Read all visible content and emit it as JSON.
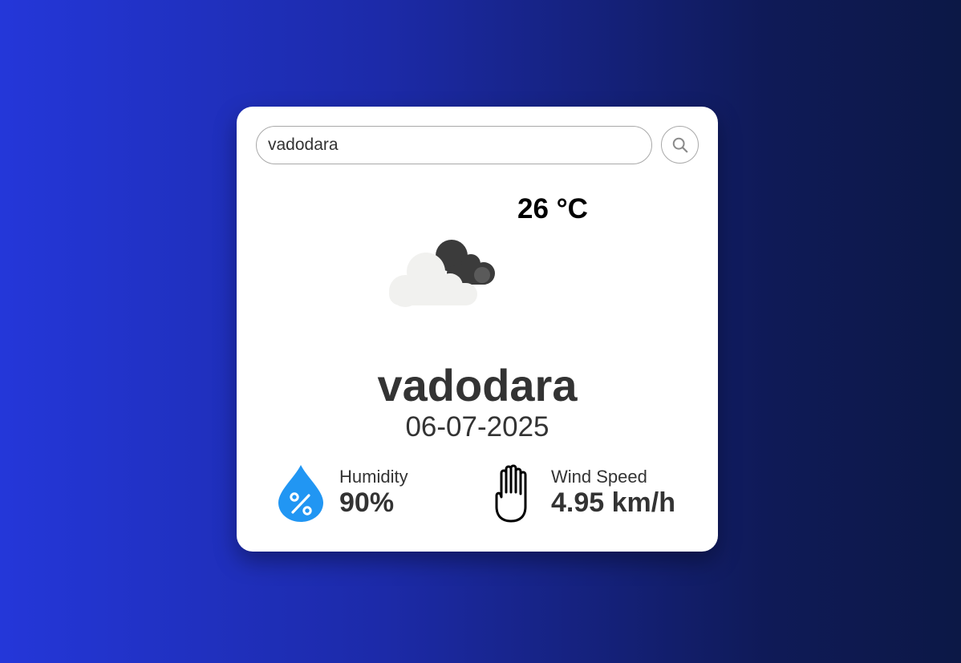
{
  "search": {
    "value": "vadodara",
    "placeholder": ""
  },
  "weather": {
    "temperature": "26 °C",
    "icon": "cloudy-icon",
    "city": "vadodara",
    "date": "06-07-2025"
  },
  "details": {
    "humidity": {
      "label": "Humidity",
      "value": "90%",
      "icon": "humidity-drop-icon"
    },
    "wind": {
      "label": "Wind Speed",
      "value": "4.95 km/h",
      "icon": "hand-icon"
    }
  },
  "colors": {
    "background_start": "#2437d9",
    "background_end": "#0c1846",
    "card": "#ffffff",
    "text": "#333333",
    "humidity_icon": "#2196f3"
  }
}
